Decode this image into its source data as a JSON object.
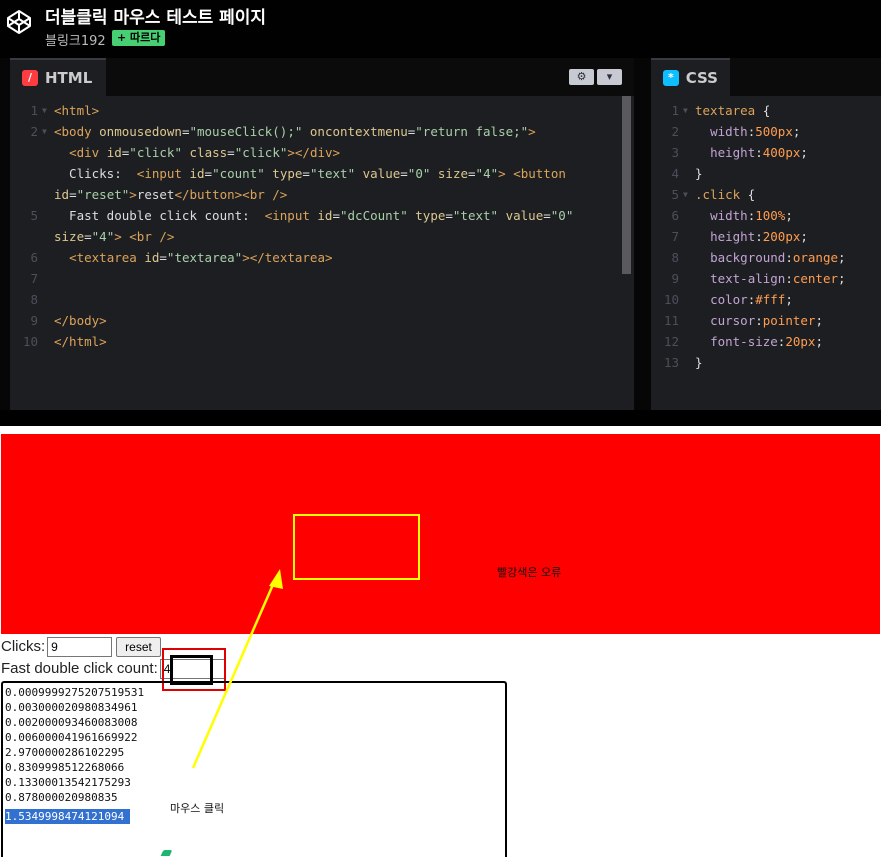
{
  "header": {
    "title": "더블클릭 마우스 테스트 페이지",
    "author": "블링크192",
    "follow_label": "+ 따르다"
  },
  "html_panel": {
    "label": "HTML",
    "icon": "html-icon",
    "settings_icon": "gear-icon",
    "collapse_icon": "chevron-down-icon",
    "lines": [
      {
        "n": "1",
        "fold": true,
        "parts": [
          [
            "tag",
            "<html>"
          ]
        ]
      },
      {
        "n": "2",
        "fold": true,
        "parts": [
          [
            "tag",
            "<body "
          ],
          [
            "attr",
            "onmousedown"
          ],
          [
            "punc",
            "="
          ],
          [
            "str",
            "\"mouseClick();\""
          ],
          [
            "punc",
            " "
          ],
          [
            "attr",
            "oncontextmenu"
          ],
          [
            "punc",
            "="
          ],
          [
            "str",
            "\"return false;\""
          ],
          [
            "tag",
            ">"
          ]
        ]
      },
      {
        "n": "",
        "fold": false,
        "parts": [
          [
            "punc",
            "  "
          ],
          [
            "tag",
            "<div "
          ],
          [
            "attr",
            "id"
          ],
          [
            "punc",
            "="
          ],
          [
            "str",
            "\"click\""
          ],
          [
            "punc",
            " "
          ],
          [
            "attr",
            "class"
          ],
          [
            "punc",
            "="
          ],
          [
            "str",
            "\"click\""
          ],
          [
            "tag",
            "></div>"
          ]
        ]
      },
      {
        "n": "",
        "fold": false,
        "parts": [
          [
            "punc",
            "  Clicks:  "
          ],
          [
            "tag",
            "<input "
          ],
          [
            "attr",
            "id"
          ],
          [
            "punc",
            "="
          ],
          [
            "str",
            "\"count\""
          ],
          [
            "punc",
            " "
          ],
          [
            "attr",
            "type"
          ],
          [
            "punc",
            "="
          ],
          [
            "str",
            "\"text\""
          ],
          [
            "punc",
            " "
          ],
          [
            "attr",
            "value"
          ],
          [
            "punc",
            "="
          ],
          [
            "str",
            "\"0\""
          ],
          [
            "punc",
            " "
          ],
          [
            "attr",
            "size"
          ],
          [
            "punc",
            "="
          ],
          [
            "str",
            "\"4\""
          ],
          [
            "tag",
            ">"
          ],
          [
            "punc",
            " "
          ],
          [
            "tag",
            "<button"
          ]
        ]
      },
      {
        "n": "",
        "fold": false,
        "parts": [
          [
            "attr",
            "id"
          ],
          [
            "punc",
            "="
          ],
          [
            "str",
            "\"reset\""
          ],
          [
            "tag",
            ">"
          ],
          [
            "punc",
            "reset"
          ],
          [
            "tag",
            "</button><br />"
          ]
        ]
      },
      {
        "n": "5",
        "fold": false,
        "parts": [
          [
            "punc",
            "  Fast double click count:  "
          ],
          [
            "tag",
            "<input "
          ],
          [
            "attr",
            "id"
          ],
          [
            "punc",
            "="
          ],
          [
            "str",
            "\"dcCount\""
          ],
          [
            "punc",
            " "
          ],
          [
            "attr",
            "type"
          ],
          [
            "punc",
            "="
          ],
          [
            "str",
            "\"text\""
          ],
          [
            "punc",
            " "
          ],
          [
            "attr",
            "value"
          ],
          [
            "punc",
            "="
          ],
          [
            "str",
            "\"0\""
          ]
        ]
      },
      {
        "n": "",
        "fold": false,
        "parts": [
          [
            "attr",
            "size"
          ],
          [
            "punc",
            "="
          ],
          [
            "str",
            "\"4\""
          ],
          [
            "tag",
            ">"
          ],
          [
            "punc",
            " "
          ],
          [
            "tag",
            "<br />"
          ]
        ]
      },
      {
        "n": "6",
        "fold": false,
        "parts": [
          [
            "punc",
            "  "
          ],
          [
            "tag",
            "<textarea "
          ],
          [
            "attr",
            "id"
          ],
          [
            "punc",
            "="
          ],
          [
            "str",
            "\"textarea\""
          ],
          [
            "tag",
            "></textarea>"
          ]
        ]
      },
      {
        "n": "7",
        "fold": false,
        "parts": []
      },
      {
        "n": "8",
        "fold": false,
        "parts": []
      },
      {
        "n": "9",
        "fold": false,
        "parts": [
          [
            "tag",
            "</body>"
          ]
        ]
      },
      {
        "n": "10",
        "fold": false,
        "parts": [
          [
            "tag",
            "</html>"
          ]
        ]
      }
    ]
  },
  "css_panel": {
    "label": "CSS",
    "icon": "css-icon",
    "lines": [
      {
        "n": "1",
        "fold": true,
        "parts": [
          [
            "sel",
            "textarea"
          ],
          [
            "punc",
            " {"
          ]
        ]
      },
      {
        "n": "2",
        "fold": false,
        "parts": [
          [
            "punc",
            "  "
          ],
          [
            "prop",
            "width"
          ],
          [
            "punc",
            ":"
          ],
          [
            "val",
            "500px"
          ],
          [
            "punc",
            ";"
          ]
        ]
      },
      {
        "n": "3",
        "fold": false,
        "parts": [
          [
            "punc",
            "  "
          ],
          [
            "prop",
            "height"
          ],
          [
            "punc",
            ":"
          ],
          [
            "val",
            "400px"
          ],
          [
            "punc",
            ";"
          ]
        ]
      },
      {
        "n": "4",
        "fold": false,
        "parts": [
          [
            "punc",
            "}"
          ]
        ]
      },
      {
        "n": "5",
        "fold": true,
        "parts": [
          [
            "sel",
            ".click"
          ],
          [
            "punc",
            " {"
          ]
        ]
      },
      {
        "n": "6",
        "fold": false,
        "parts": [
          [
            "punc",
            "  "
          ],
          [
            "prop",
            "width"
          ],
          [
            "punc",
            ":"
          ],
          [
            "val",
            "100%"
          ],
          [
            "punc",
            ";"
          ]
        ]
      },
      {
        "n": "7",
        "fold": false,
        "parts": [
          [
            "punc",
            "  "
          ],
          [
            "prop",
            "height"
          ],
          [
            "punc",
            ":"
          ],
          [
            "val",
            "200px"
          ],
          [
            "punc",
            ";"
          ]
        ]
      },
      {
        "n": "8",
        "fold": false,
        "parts": [
          [
            "punc",
            "  "
          ],
          [
            "prop",
            "background"
          ],
          [
            "punc",
            ":"
          ],
          [
            "val",
            "orange"
          ],
          [
            "punc",
            ";"
          ]
        ]
      },
      {
        "n": "9",
        "fold": false,
        "parts": [
          [
            "punc",
            "  "
          ],
          [
            "prop",
            "text-align"
          ],
          [
            "punc",
            ":"
          ],
          [
            "val",
            "center"
          ],
          [
            "punc",
            ";"
          ]
        ]
      },
      {
        "n": "10",
        "fold": false,
        "parts": [
          [
            "punc",
            "  "
          ],
          [
            "prop",
            "color"
          ],
          [
            "punc",
            ":"
          ],
          [
            "val",
            "#fff"
          ],
          [
            "punc",
            ";"
          ]
        ]
      },
      {
        "n": "11",
        "fold": false,
        "parts": [
          [
            "punc",
            "  "
          ],
          [
            "prop",
            "cursor"
          ],
          [
            "punc",
            ":"
          ],
          [
            "val",
            "pointer"
          ],
          [
            "punc",
            ";"
          ]
        ]
      },
      {
        "n": "12",
        "fold": false,
        "parts": [
          [
            "punc",
            "  "
          ],
          [
            "prop",
            "font-size"
          ],
          [
            "punc",
            ":"
          ],
          [
            "val",
            "20px"
          ],
          [
            "punc",
            ";"
          ]
        ]
      },
      {
        "n": "13",
        "fold": false,
        "parts": [
          [
            "punc",
            "}"
          ]
        ]
      }
    ]
  },
  "result": {
    "red_note": "빨강색은 오류",
    "clicks_label": "Clicks:",
    "clicks_value": "9",
    "reset_label": "reset",
    "dc_label": "Fast double click count:",
    "dc_value": "4",
    "log_lines": [
      "0.0009999275207519531",
      "0.003000020980834961",
      "0.002000093460083008",
      "0.006000041961669922",
      "2.9700000286102295",
      "0.8309998512268066",
      "0.13300013542175293",
      "0.878000020980835",
      "1.5349998474121094"
    ],
    "selected_line": 8,
    "mouse_note": "마우스 클릭"
  },
  "colors": {
    "click_area": "#ff0000",
    "highlight_yellow": "#ffff00",
    "highlight_red": "#e00000",
    "follow_green": "#47cf73",
    "selection_blue": "#3271cf"
  }
}
